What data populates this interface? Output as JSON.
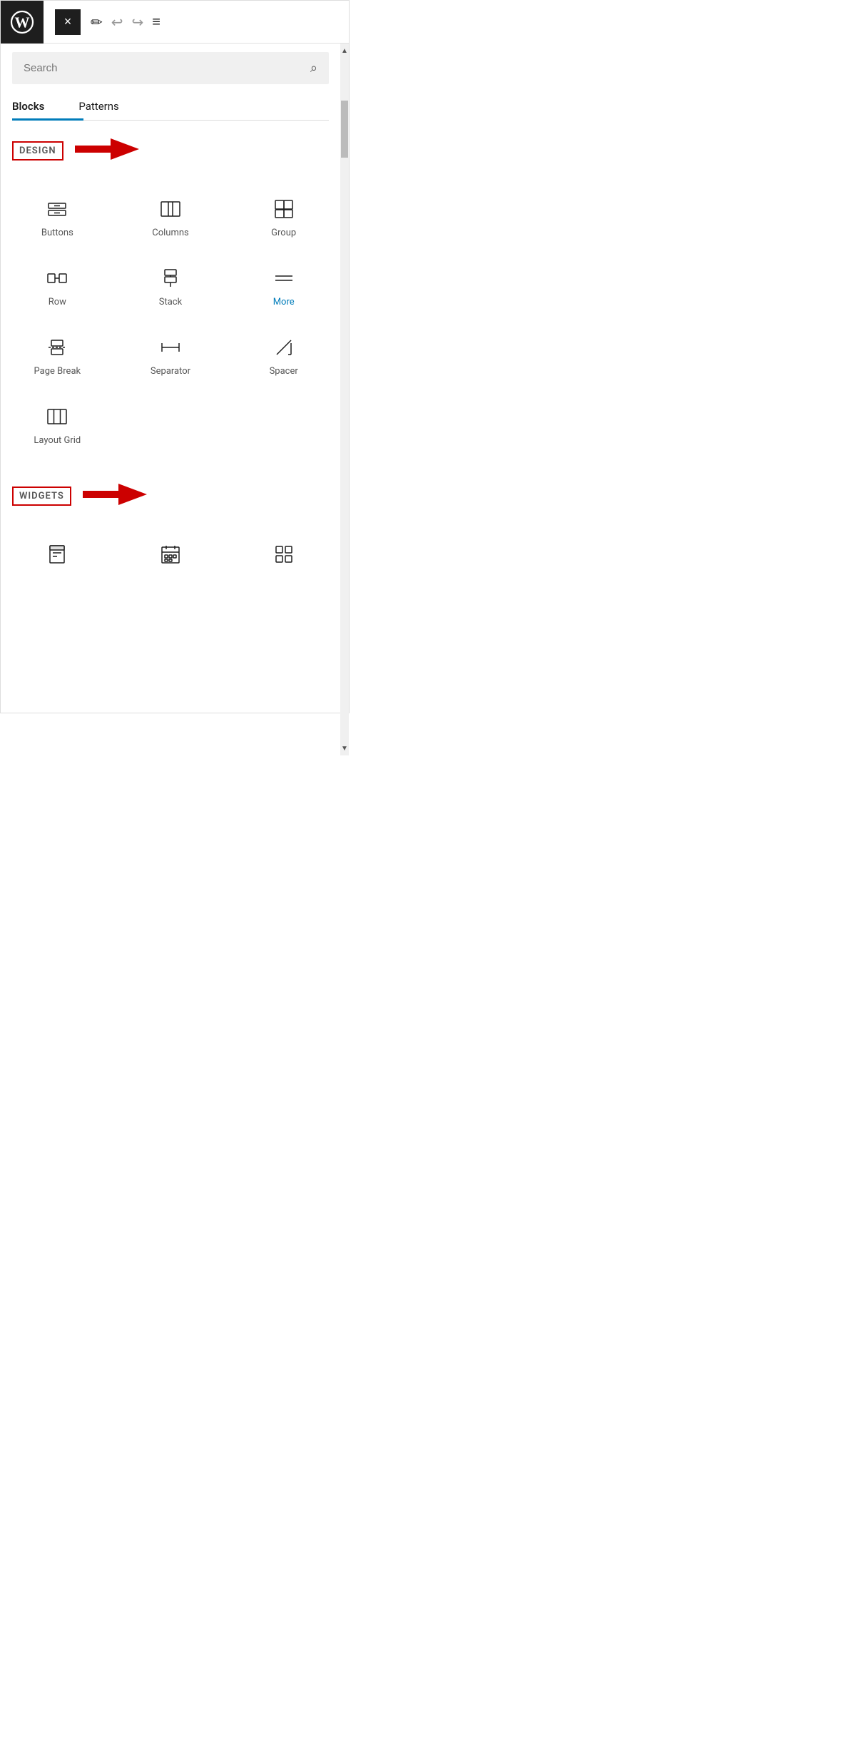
{
  "header": {
    "close_label": "×",
    "edit_icon": "✏",
    "undo_icon": "↩",
    "redo_icon": "↪",
    "menu_icon": "≡"
  },
  "search": {
    "placeholder": "Search",
    "icon": "🔍"
  },
  "tabs": [
    {
      "label": "Blocks",
      "active": true
    },
    {
      "label": "Patterns",
      "active": false
    }
  ],
  "sections": [
    {
      "name": "DESIGN",
      "highlighted": true,
      "blocks": [
        {
          "label": "Buttons",
          "icon": "buttons"
        },
        {
          "label": "Columns",
          "icon": "columns"
        },
        {
          "label": "Group",
          "icon": "group"
        },
        {
          "label": "Row",
          "icon": "row"
        },
        {
          "label": "Stack",
          "icon": "stack"
        },
        {
          "label": "More",
          "icon": "more",
          "highlight": true
        },
        {
          "label": "Page Break",
          "icon": "pagebreak"
        },
        {
          "label": "Separator",
          "icon": "separator"
        },
        {
          "label": "Spacer",
          "icon": "spacer"
        },
        {
          "label": "Layout Grid",
          "icon": "layoutgrid"
        }
      ]
    },
    {
      "name": "WIDGETS",
      "highlighted": true,
      "blocks": [
        {
          "label": "",
          "icon": "widget1"
        },
        {
          "label": "",
          "icon": "widget2"
        },
        {
          "label": "",
          "icon": "widget3"
        }
      ]
    }
  ],
  "scrollbar": {
    "arrow_up": "▲",
    "arrow_down": "▼"
  }
}
